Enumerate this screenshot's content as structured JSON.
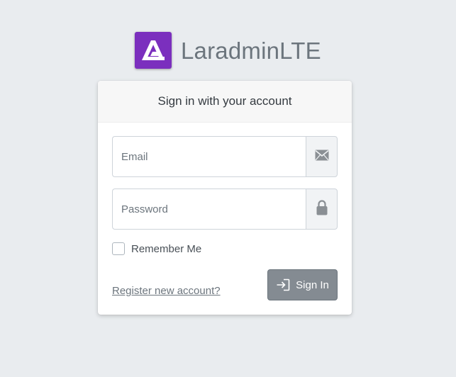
{
  "brand": {
    "name": "LaradminLTE",
    "logo_icon": "laradmin-logo-icon",
    "logo_color": "#7b2fbe"
  },
  "login_card": {
    "header": "Sign in with your account",
    "email": {
      "placeholder": "Email",
      "value": "",
      "icon": "envelope-icon"
    },
    "password": {
      "placeholder": "Password",
      "value": "",
      "icon": "lock-icon"
    },
    "remember": {
      "label": "Remember Me",
      "checked": false
    },
    "register_link": "Register new account?",
    "signin_button": {
      "label": "Sign In",
      "icon": "sign-in-icon",
      "color": "#848b92"
    }
  },
  "colors": {
    "page_background": "#e9ecef",
    "card_header_background": "#f7f7f7"
  }
}
